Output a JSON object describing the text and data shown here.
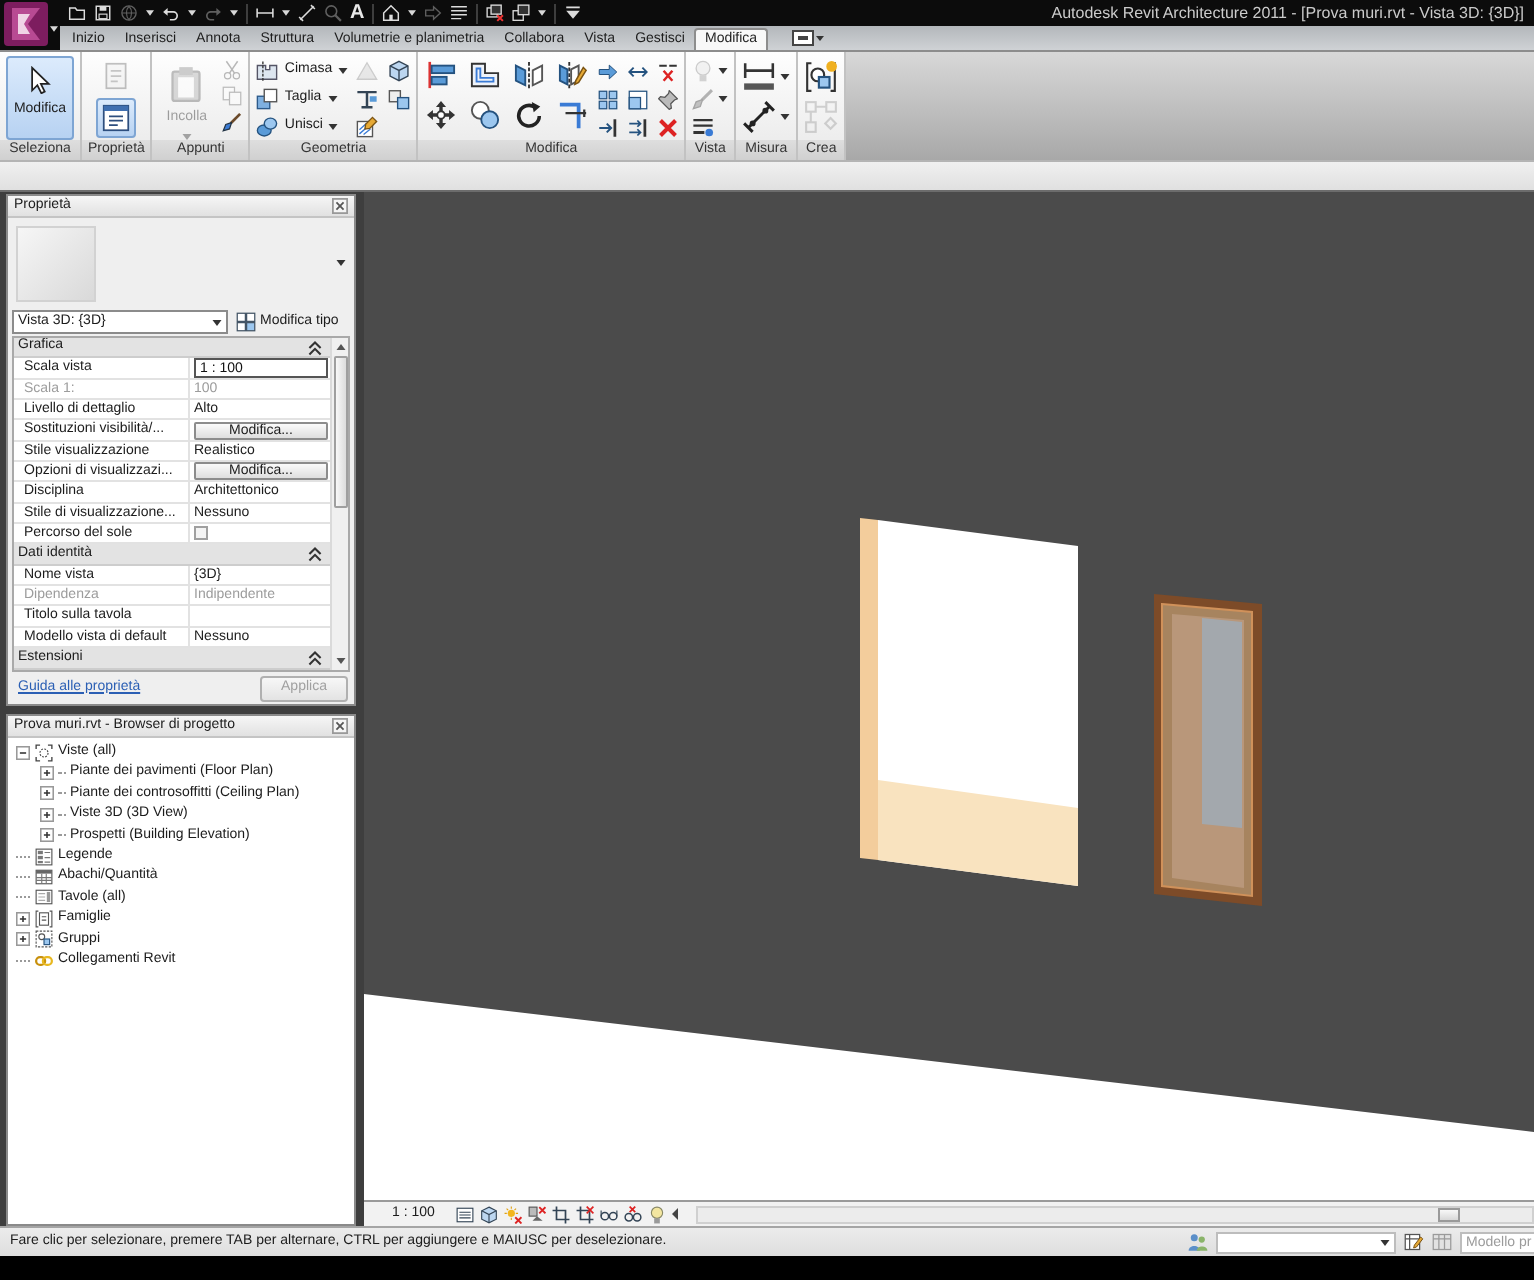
{
  "window": {
    "title": "Autodesk Revit Architecture 2011 - [Prova muri.rvt - Vista 3D: {3D}]"
  },
  "quick_access": [
    {
      "tools": [
        {
          "kind": "folder",
          "disabled": false
        },
        {
          "kind": "disk",
          "disabled": false
        },
        {
          "kind": "globe",
          "disabled": true,
          "dropdown": true
        },
        {
          "kind": "undo",
          "disabled": false,
          "dropdown": true
        },
        {
          "kind": "redo",
          "disabled": true,
          "dropdown": true
        }
      ]
    },
    {
      "tools": [
        {
          "kind": "ruler",
          "disabled": false,
          "dropdown": true
        },
        {
          "kind": "qdim",
          "disabled": false
        },
        {
          "kind": "magnifier",
          "disabled": true
        },
        {
          "kind": "text",
          "label": "A",
          "disabled": false
        }
      ]
    },
    {
      "tools": [
        {
          "kind": "house",
          "disabled": false,
          "dropdown": true
        },
        {
          "kind": "hollowarrow",
          "disabled": true
        },
        {
          "kind": "lines",
          "disabled": false
        }
      ]
    },
    {
      "tools": [
        {
          "kind": "winx",
          "disabled": false
        },
        {
          "kind": "windows",
          "disabled": false,
          "dropdown": true
        }
      ]
    },
    {
      "tools": [
        {
          "kind": "customize",
          "disabled": false
        }
      ]
    }
  ],
  "ribbon": {
    "tabs": [
      {
        "label": "Inizio",
        "selected": false
      },
      {
        "label": "Inserisci",
        "selected": false
      },
      {
        "label": "Annota",
        "selected": false
      },
      {
        "label": "Struttura",
        "selected": false
      },
      {
        "label": "Volumetrie e planimetria",
        "selected": false
      },
      {
        "label": "Collabora",
        "selected": false
      },
      {
        "label": "Vista",
        "selected": false
      },
      {
        "label": "Gestisci",
        "selected": false
      },
      {
        "label": "Modifica",
        "selected": true
      }
    ],
    "panels": [
      {
        "label": "Seleziona",
        "kind": "select",
        "tools": [
          {
            "kind": "pointer",
            "label": "Modifica",
            "selected": true,
            "disabled": false
          }
        ]
      },
      {
        "label": "Proprietà",
        "kind": "properties",
        "tools": [
          {
            "kind": "document",
            "selected": false,
            "disabled": true
          },
          {
            "kind": "form",
            "selected": true,
            "disabled": false
          }
        ]
      },
      {
        "label": "Appunti",
        "kind": "clipboard",
        "tools": [
          {
            "kind": "clipboard",
            "label": "Incolla",
            "disabled": true,
            "dropdown": true
          },
          {
            "kind": "scissors",
            "disabled": true
          },
          {
            "kind": "pages",
            "disabled": true
          },
          {
            "kind": "brush",
            "disabled": false
          }
        ]
      },
      {
        "label": "Geometria",
        "kind": "geometry",
        "tools": [
          {
            "kind": "notch",
            "label": "Cimasa",
            "disabled": false,
            "dropdown": true
          },
          {
            "kind": "squares",
            "label": "Taglia",
            "disabled": false,
            "dropdown": true
          },
          {
            "kind": "cylinders",
            "label": "Unisci",
            "disabled": false,
            "dropdown": true
          },
          {
            "kind": "block",
            "disabled": true
          },
          {
            "kind": "beam",
            "disabled": false
          },
          {
            "kind": "stripes",
            "disabled": false
          },
          {
            "kind": "cube",
            "disabled": false
          },
          {
            "kind": "faces",
            "disabled": false
          }
        ]
      },
      {
        "label": "Modifica",
        "kind": "modify",
        "tools": [
          {
            "kind": "bars",
            "disabled": false
          },
          {
            "kind": "outline",
            "disabled": false
          },
          {
            "kind": "mirror",
            "disabled": false
          },
          {
            "kind": "mirrorpen",
            "disabled": false
          },
          {
            "kind": "crossarrows",
            "disabled": false
          },
          {
            "kind": "circles",
            "disabled": false
          },
          {
            "kind": "circlearrow",
            "disabled": false
          },
          {
            "kind": "corner",
            "disabled": false
          },
          {
            "kind": "arrowright",
            "disabled": false
          },
          {
            "kind": "arrowsplit",
            "disabled": false
          },
          {
            "kind": "splitx",
            "disabled": false
          },
          {
            "kind": "gridsq",
            "disabled": false
          },
          {
            "kind": "frame",
            "disabled": false
          },
          {
            "kind": "pin",
            "disabled": false
          },
          {
            "kind": "bararrow",
            "disabled": false
          },
          {
            "kind": "bararrows",
            "disabled": false
          },
          {
            "kind": "redx",
            "disabled": false
          }
        ]
      },
      {
        "label": "Vista",
        "kind": "column",
        "tools": [
          {
            "kind": "bulb",
            "disabled": true,
            "dropdown": true
          },
          {
            "kind": "brush",
            "disabled": true,
            "dropdown": true
          },
          {
            "kind": "linedot",
            "disabled": false
          }
        ]
      },
      {
        "label": "Misura",
        "kind": "stack",
        "tools": [
          {
            "kind": "hdim",
            "disabled": false,
            "dropdown": true
          },
          {
            "kind": "ddim",
            "disabled": false,
            "dropdown": true
          }
        ]
      },
      {
        "label": "Crea",
        "kind": "stack",
        "tools": [
          {
            "kind": "group",
            "disabled": false
          },
          {
            "kind": "flow",
            "disabled": true
          }
        ]
      }
    ]
  },
  "properties": {
    "title": "Proprietà",
    "type_selector": "Vista 3D: {3D}",
    "edit_type_button": "Modifica tipo",
    "groups": [
      {
        "label": "Grafica",
        "expanded": true,
        "rows": [
          {
            "kind": "input",
            "name": "Scala vista",
            "value": "1 : 100",
            "disabled": false
          },
          {
            "kind": "text",
            "name": "Scala 1:",
            "value": "100",
            "disabled": true
          },
          {
            "kind": "text",
            "name": "Livello di dettaglio",
            "value": "Alto",
            "disabled": false
          },
          {
            "kind": "button",
            "name": "Sostituzioni visibilità/...",
            "value": "Modifica...",
            "disabled": false
          },
          {
            "kind": "text",
            "name": "Stile visualizzazione",
            "value": "Realistico",
            "disabled": false
          },
          {
            "kind": "button",
            "name": "Opzioni di visualizzazi...",
            "value": "Modifica...",
            "disabled": false
          },
          {
            "kind": "text",
            "name": "Disciplina",
            "value": "Architettonico",
            "disabled": false
          },
          {
            "kind": "text",
            "name": "Stile di visualizzazione...",
            "value": "Nessuno",
            "disabled": false
          },
          {
            "kind": "checkbox",
            "name": "Percorso del sole",
            "checked": false,
            "disabled": false
          }
        ]
      },
      {
        "label": "Dati identità",
        "expanded": true,
        "rows": [
          {
            "kind": "text",
            "name": "Nome vista",
            "value": "{3D}",
            "disabled": false
          },
          {
            "kind": "text",
            "name": "Dipendenza",
            "value": "Indipendente",
            "disabled": true
          },
          {
            "kind": "text",
            "name": "Titolo sulla tavola",
            "disabled": false
          },
          {
            "kind": "text",
            "name": "Modello vista di default",
            "value": "Nessuno",
            "disabled": false
          }
        ]
      },
      {
        "label": "Estensioni",
        "expanded": true
      }
    ],
    "help_link": "Guida alle proprietà",
    "apply_button": {
      "label": "Applica",
      "disabled": true
    }
  },
  "project_browser": {
    "title": "Prova muri.rvt - Browser di progetto",
    "tree": [
      {
        "kind": "views",
        "label": "Viste (all)",
        "expanded": true,
        "children": [
          {
            "label": "Piante dei pavimenti (Floor Plan)",
            "expanded": false
          },
          {
            "label": "Piante dei controsoffitti (Ceiling Plan)",
            "expanded": false
          },
          {
            "label": "Viste 3D (3D View)",
            "expanded": false
          },
          {
            "label": "Prospetti (Building Elevation)",
            "expanded": false
          }
        ]
      },
      {
        "kind": "legends",
        "label": "Legende"
      },
      {
        "kind": "schedules",
        "label": "Abachi/Quantità"
      },
      {
        "kind": "sheets",
        "label": "Tavole (all)"
      },
      {
        "kind": "families",
        "label": "Famiglie",
        "expanded": false
      },
      {
        "kind": "groups",
        "label": "Gruppi",
        "expanded": false
      },
      {
        "kind": "links",
        "label": "Collegamenti Revit"
      }
    ]
  },
  "view_bar": {
    "scale": "1 : 100"
  },
  "status_bar": {
    "message": "Fare clic per selezionare, premere TAB per alternare, CTRL per aggiungere e MAIUSC per deselezionare.",
    "model_field": {
      "value": "Modello pr",
      "disabled": true
    }
  }
}
